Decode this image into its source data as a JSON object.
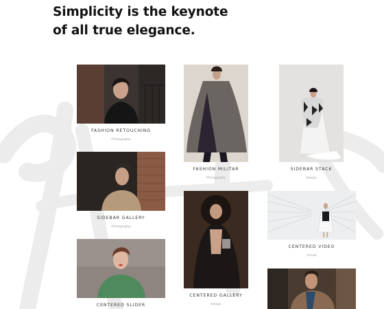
{
  "heading": {
    "line1": "Simplicity is the keynote",
    "line2": "of all true elegance."
  },
  "portfolio": [
    {
      "id": "c1",
      "title": "FASHION RETOUCHING",
      "category": "Photography"
    },
    {
      "id": "c2",
      "title": "SIDEBAR GALLERY",
      "category": "Photography"
    },
    {
      "id": "c3",
      "title": "CENTERED SLIDER",
      "category": ""
    },
    {
      "id": "c4",
      "title": "FASHION MILITAR",
      "category": "Photography"
    },
    {
      "id": "c5",
      "title": "CENTERED GALLERY",
      "category": "Design"
    },
    {
      "id": "c6",
      "title": "SIDEBAR STACK",
      "category": "Design"
    },
    {
      "id": "c7",
      "title": "CENTERED VIDEO",
      "category": "Trends"
    },
    {
      "id": "c8",
      "title": "",
      "category": ""
    }
  ]
}
